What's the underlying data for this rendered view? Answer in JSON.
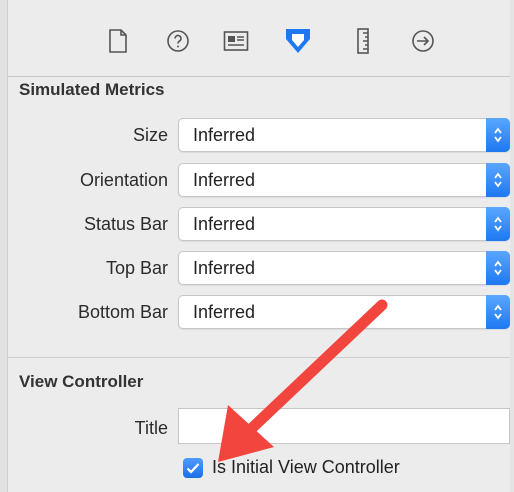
{
  "toolbar": {
    "icons": [
      "file-icon",
      "help-icon",
      "identity-icon",
      "attributes-icon",
      "size-icon",
      "connections-icon"
    ]
  },
  "simulated_metrics": {
    "header": "Simulated Metrics",
    "rows": [
      {
        "label": "Size",
        "value": "Inferred"
      },
      {
        "label": "Orientation",
        "value": "Inferred"
      },
      {
        "label": "Status Bar",
        "value": "Inferred"
      },
      {
        "label": "Top Bar",
        "value": "Inferred"
      },
      {
        "label": "Bottom Bar",
        "value": "Inferred"
      }
    ]
  },
  "view_controller": {
    "header": "View Controller",
    "title_label": "Title",
    "title_value": "",
    "initial_checkbox_label": "Is Initial View Controller",
    "initial_checked": true
  },
  "colors": {
    "accent": "#1d78f2",
    "annotation_arrow": "#f2453d"
  }
}
